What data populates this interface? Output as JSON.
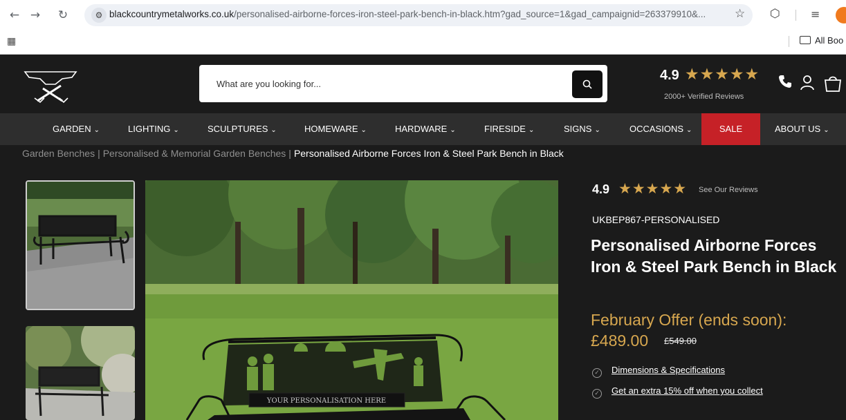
{
  "browser": {
    "url_host": "blackcountrymetalworks.co.uk",
    "url_path": "/personalised-airborne-forces-iron-steel-park-bench-in-black.htm?gad_source=1&gad_campaignid=263379910&...",
    "bookmarks_folder": "All Boo"
  },
  "header": {
    "search_placeholder": "What are you looking for...",
    "rating": "4.9",
    "stars": "★★★★★",
    "verified_reviews": "2000+ Verified Reviews"
  },
  "nav": {
    "items": [
      "GARDEN",
      "LIGHTING",
      "SCULPTURES",
      "HOMEWARE",
      "HARDWARE",
      "FIRESIDE",
      "SIGNS",
      "OCCASIONS"
    ],
    "sale": "SALE",
    "about": "ABOUT US"
  },
  "breadcrumb": {
    "items": [
      "Garden Benches",
      "Personalised & Memorial Garden Benches"
    ],
    "current": "Personalised Airborne Forces Iron & Steel Park Bench in Black"
  },
  "product": {
    "rating": "4.9",
    "stars": "★★★★★",
    "see_reviews": "See Our Reviews",
    "sku": "UKBEP867-PERSONALISED",
    "title": "Personalised Airborne Forces Iron & Steel Park Bench in Black",
    "offer": "February Offer (ends soon):",
    "price": "£489.00",
    "old_price": "£549.00",
    "links": [
      "Dimensions & Specifications",
      "Get an extra 15% off when you collect"
    ],
    "plaque_text": "YOUR PERSONALISATION HERE"
  },
  "colors": {
    "background": "#1b1b1b",
    "nav_bg": "#2e2e2e",
    "sale_red": "#c62127",
    "gold": "#d7a74f"
  }
}
